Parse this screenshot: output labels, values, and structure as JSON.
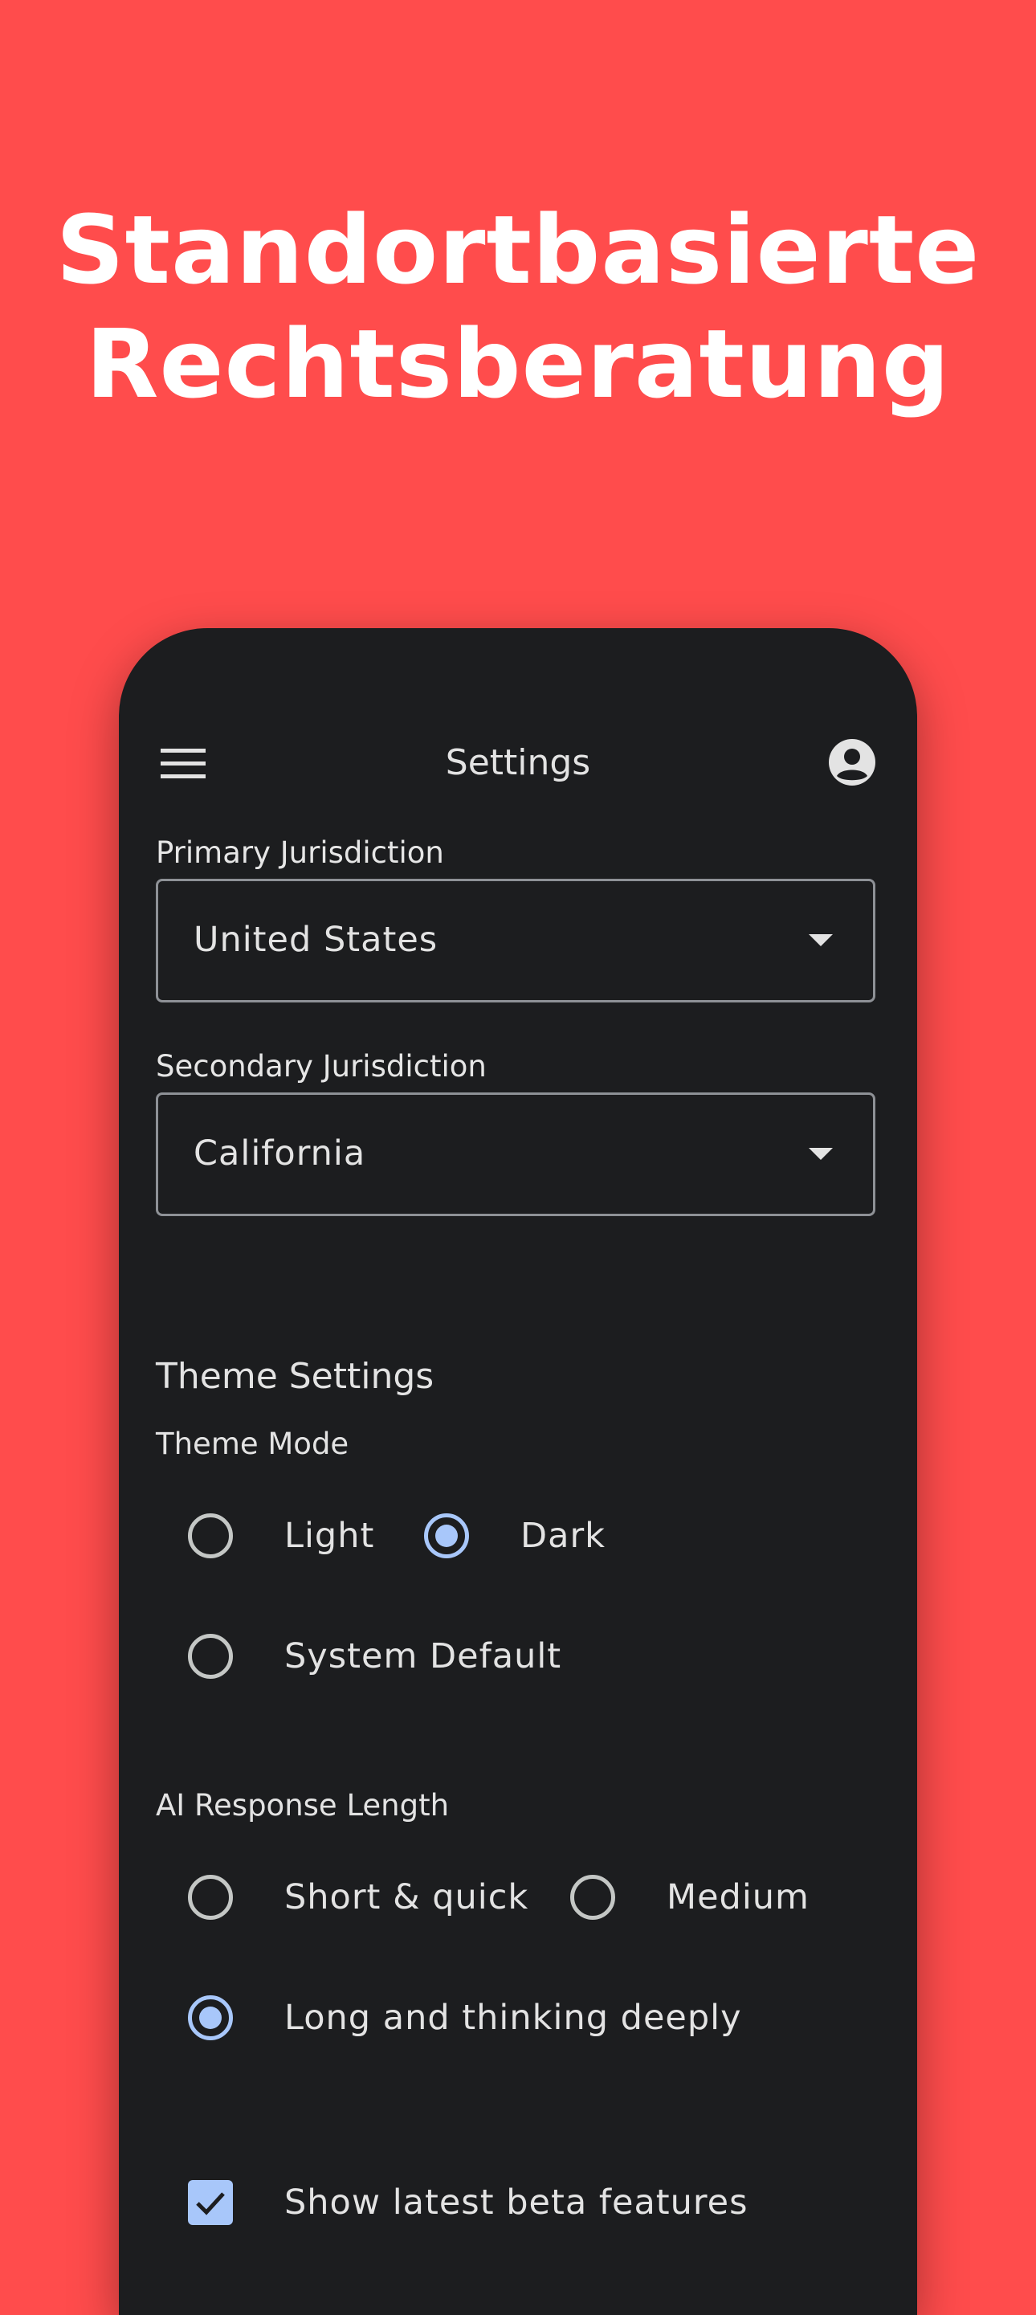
{
  "headline": {
    "line1": "Standortbasierte",
    "line2": "Rechtsberatung"
  },
  "appbar": {
    "title": "Settings",
    "menu_icon": "menu-icon",
    "account_icon": "account-circle-icon"
  },
  "jurisdiction": {
    "primary_label": "Primary Jurisdiction",
    "primary_value": "United States",
    "secondary_label": "Secondary Jurisdiction",
    "secondary_value": "California"
  },
  "theme": {
    "section_title": "Theme Settings",
    "mode_label": "Theme Mode",
    "options": [
      {
        "label": "Light",
        "selected": false
      },
      {
        "label": "Dark",
        "selected": true
      },
      {
        "label": "System Default",
        "selected": false
      }
    ]
  },
  "ai_response": {
    "label": "AI Response Length",
    "options": [
      {
        "label": "Short & quick",
        "selected": false
      },
      {
        "label": "Medium",
        "selected": false
      },
      {
        "label": "Long and thinking deeply",
        "selected": true
      }
    ]
  },
  "beta": {
    "label": "Show latest beta features",
    "checked": true
  },
  "colors": {
    "background": "#FF4C4C",
    "surface": "#1C1D1F",
    "accent": "#A8C7FA"
  }
}
